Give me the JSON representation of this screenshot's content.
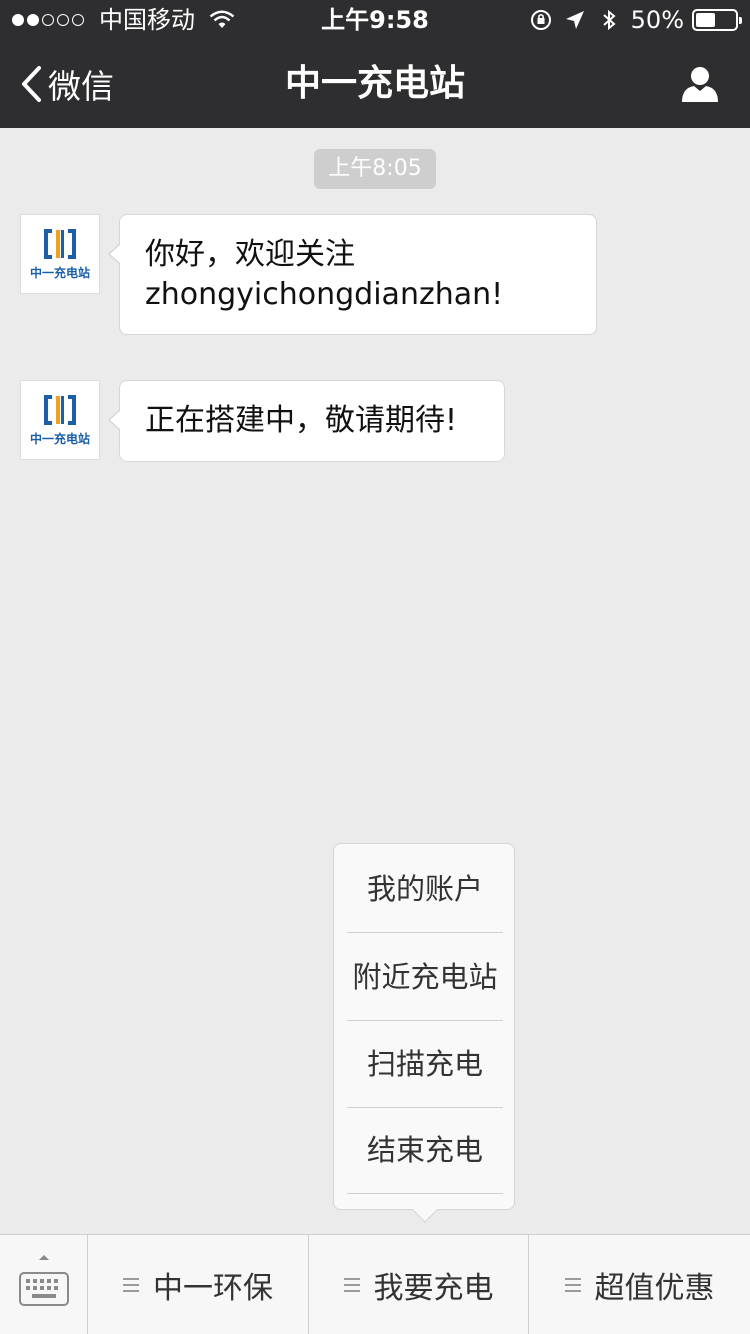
{
  "status_bar": {
    "carrier": "中国移动",
    "time": "上午9:58",
    "battery_percent_label": "50%",
    "battery_level": 0.5,
    "signal_bars_filled": 2,
    "signal_bars_total": 5
  },
  "nav": {
    "back_label": "微信",
    "title": "中一充电站"
  },
  "chat": {
    "timestamp": "上午8:05",
    "avatar_text": "中一充电站",
    "messages": [
      {
        "line1": "你好，欢迎关注",
        "line2": "zhongyichongdianzhan!"
      },
      {
        "line1": "正在搭建中，敬请期待!"
      }
    ]
  },
  "submenu": {
    "items": [
      "我的账户",
      "附近充电站",
      "扫描充电",
      "结束充电"
    ]
  },
  "bottom_menu": {
    "tabs": [
      "中一环保",
      "我要充电",
      "超值优惠"
    ]
  },
  "colors": {
    "nav_bg": "#2e2e30",
    "chat_bg": "#ebebeb",
    "logo_blue": "#1a5fa8",
    "logo_orange": "#f0a020"
  }
}
